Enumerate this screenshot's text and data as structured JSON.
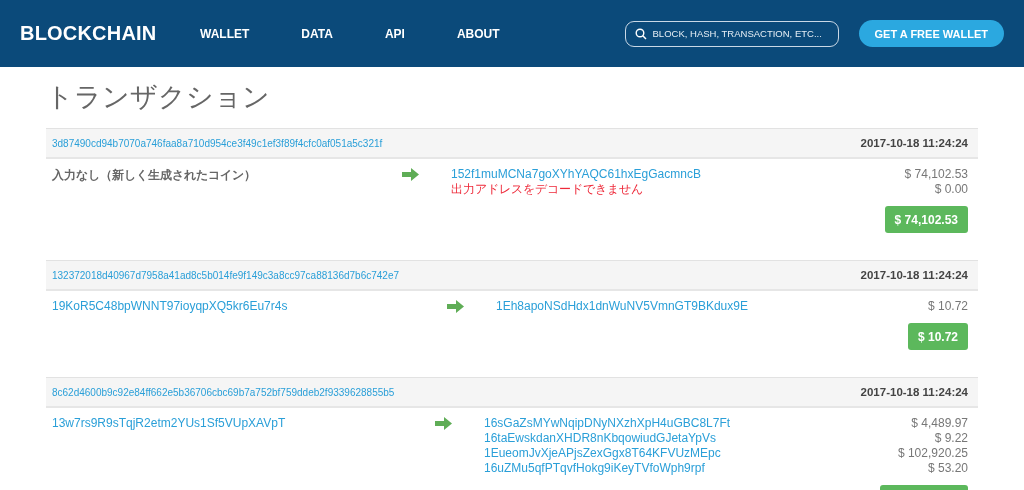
{
  "header": {
    "logo": "BLOCKCHAIN",
    "nav": [
      {
        "label": "WALLET"
      },
      {
        "label": "DATA"
      },
      {
        "label": "API"
      },
      {
        "label": "ABOUT"
      }
    ],
    "search": {
      "placeholder": "BLOCK, HASH, TRANSACTION, ETC..."
    },
    "cta": "GET A FREE WALLET"
  },
  "page_title": "トランザクション",
  "transactions": [
    {
      "hash": "3d87490cd94b7070a746faa8a710d954ce3f49c1ef3f89f4cfc0af051a5c321f",
      "time": "2017-10-18 11:24:24",
      "inputs": [
        {
          "kind": "note",
          "text": "入力なし（新しく生成されたコイン）"
        }
      ],
      "outputs": [
        {
          "kind": "address",
          "text": "152f1muMCNa7goXYhYAQC61hxEgGacmncB"
        },
        {
          "kind": "error",
          "text": "出力アドレスをデコードできません"
        }
      ],
      "amounts": [
        "$ 74,102.53",
        "$ 0.00"
      ],
      "total": "$ 74,102.53"
    },
    {
      "hash": "132372018d40967d7958a41ad8c5b014fe9f149c3a8cc97ca88136d7b6c742e7",
      "time": "2017-10-18 11:24:24",
      "inputs": [
        {
          "kind": "address",
          "text": "19KoR5C48bpWNNT97ioyqpXQ5kr6Eu7r4s"
        }
      ],
      "outputs": [
        {
          "kind": "address",
          "text": "1Eh8apoNSdHdx1dnWuNV5VmnGT9BKdux9E"
        }
      ],
      "amounts": [
        "$ 10.72"
      ],
      "total": "$ 10.72"
    },
    {
      "hash": "8c62d4600b9c92e84ff662e5b36706cbc69b7a752bf759ddeb2f9339628855b5",
      "time": "2017-10-18 11:24:24",
      "inputs": [
        {
          "kind": "address",
          "text": "13w7rs9R9sTqjR2etm2YUs1Sf5VUpXAVpT"
        }
      ],
      "outputs": [
        {
          "kind": "address",
          "text": "16sGaZsMYwNqipDNyNXzhXpH4uGBC8L7Ft"
        },
        {
          "kind": "address",
          "text": "16taEwskdanXHDR8nKbqowiudGJetaYpVs"
        },
        {
          "kind": "address",
          "text": "1EueomJvXjeAPjsZexGgx8T64KFVUzMEpc"
        },
        {
          "kind": "address",
          "text": "16uZMu5qfPTqvfHokg9iKeyTVfoWph9rpf"
        }
      ],
      "amounts": [
        "$ 4,489.97",
        "$ 9.22",
        "$ 102,920.25",
        "$ 53.20"
      ],
      "total_cut": true
    }
  ]
}
